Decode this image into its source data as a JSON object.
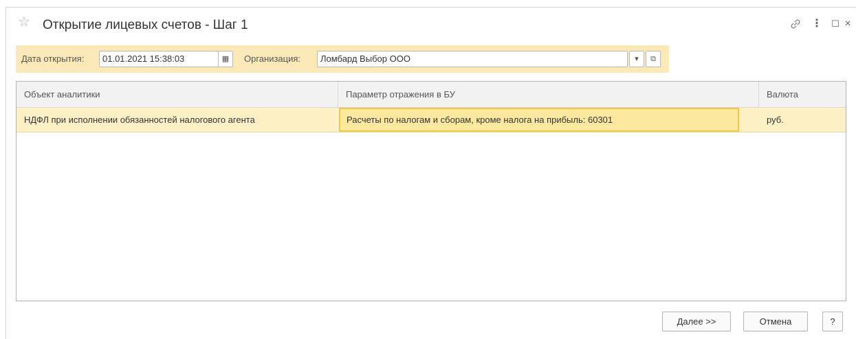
{
  "window": {
    "title": "Открытие лицевых счетов - Шаг 1",
    "favorite_icon": "☆",
    "controls": {
      "link_icon": "🔗",
      "more_icon": "⋮",
      "maximize_icon": "☐",
      "close_icon": "×"
    }
  },
  "filters": {
    "date_label": "Дата открытия:",
    "date_value": "01.01.2021 15:38:03",
    "calendar_icon": "▦",
    "org_label": "Организация:",
    "org_value": "Ломбард Выбор ООО",
    "dropdown_icon": "▾",
    "open_icon": "⧉"
  },
  "table": {
    "columns": [
      "Объект аналитики",
      "Параметр отражения в БУ",
      "Валюта"
    ],
    "rows": [
      [
        "НДФЛ при исполнении обязанностей налогового агента",
        "Расчеты по налогам и сборам, кроме налога на прибыль: 60301",
        "руб."
      ]
    ]
  },
  "buttons": {
    "next": "Далее >>",
    "cancel": "Отмена",
    "help": "?"
  },
  "colors": {
    "highlight": "#fce9b8",
    "selection_border": "#f5c842"
  }
}
